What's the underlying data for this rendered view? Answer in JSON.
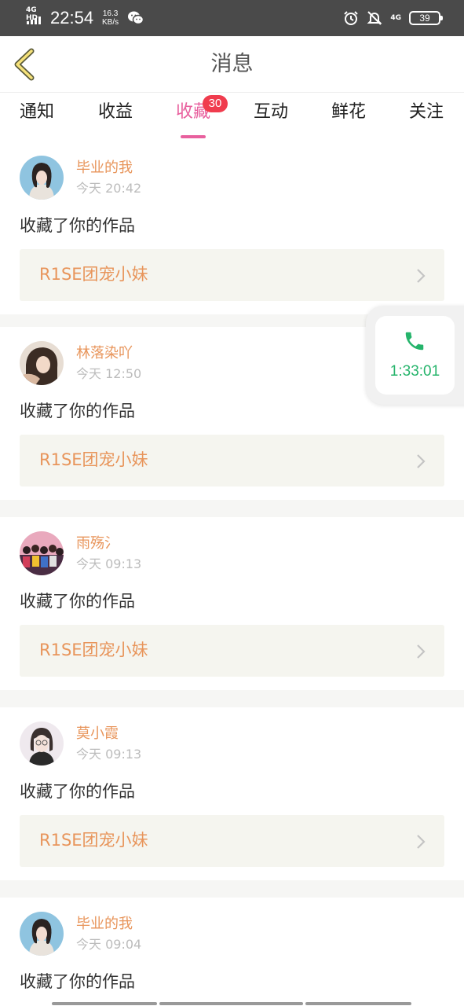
{
  "status_bar": {
    "network_label": "4G HD",
    "time": "22:54",
    "speed_value": "16.3",
    "speed_unit": "KB/s",
    "network_right": "4G",
    "battery": "39"
  },
  "header": {
    "title": "消息",
    "back_icon": "chevron-left-icon"
  },
  "tabs": [
    {
      "label": "通知"
    },
    {
      "label": "收益"
    },
    {
      "label": "收藏",
      "badge": "30",
      "active": true
    },
    {
      "label": "互动"
    },
    {
      "label": "鲜花"
    },
    {
      "label": "关注"
    }
  ],
  "colors": {
    "accent_pink": "#e8609e",
    "name_orange": "#e8955b",
    "badge_red": "#f03c4e",
    "call_green": "#25b46b"
  },
  "feed": [
    {
      "user": "毕业的我",
      "time": "今天 20:42",
      "action": "收藏了你的作品",
      "work": "R1SE团宠小妹"
    },
    {
      "user": "林落染吖",
      "time": "今天 12:50",
      "action": "收藏了你的作品",
      "work": "R1SE团宠小妹"
    },
    {
      "user": "雨殇氵",
      "time": "今天 09:13",
      "action": "收藏了你的作品",
      "work": "R1SE团宠小妹"
    },
    {
      "user": "莫小霞",
      "time": "今天 09:13",
      "action": "收藏了你的作品",
      "work": "R1SE团宠小妹"
    },
    {
      "user": "毕业的我",
      "time": "今天 09:04",
      "action": "收藏了你的作品",
      "work": ""
    }
  ],
  "floating_call": {
    "icon": "phone-icon",
    "duration": "1:33:01"
  }
}
